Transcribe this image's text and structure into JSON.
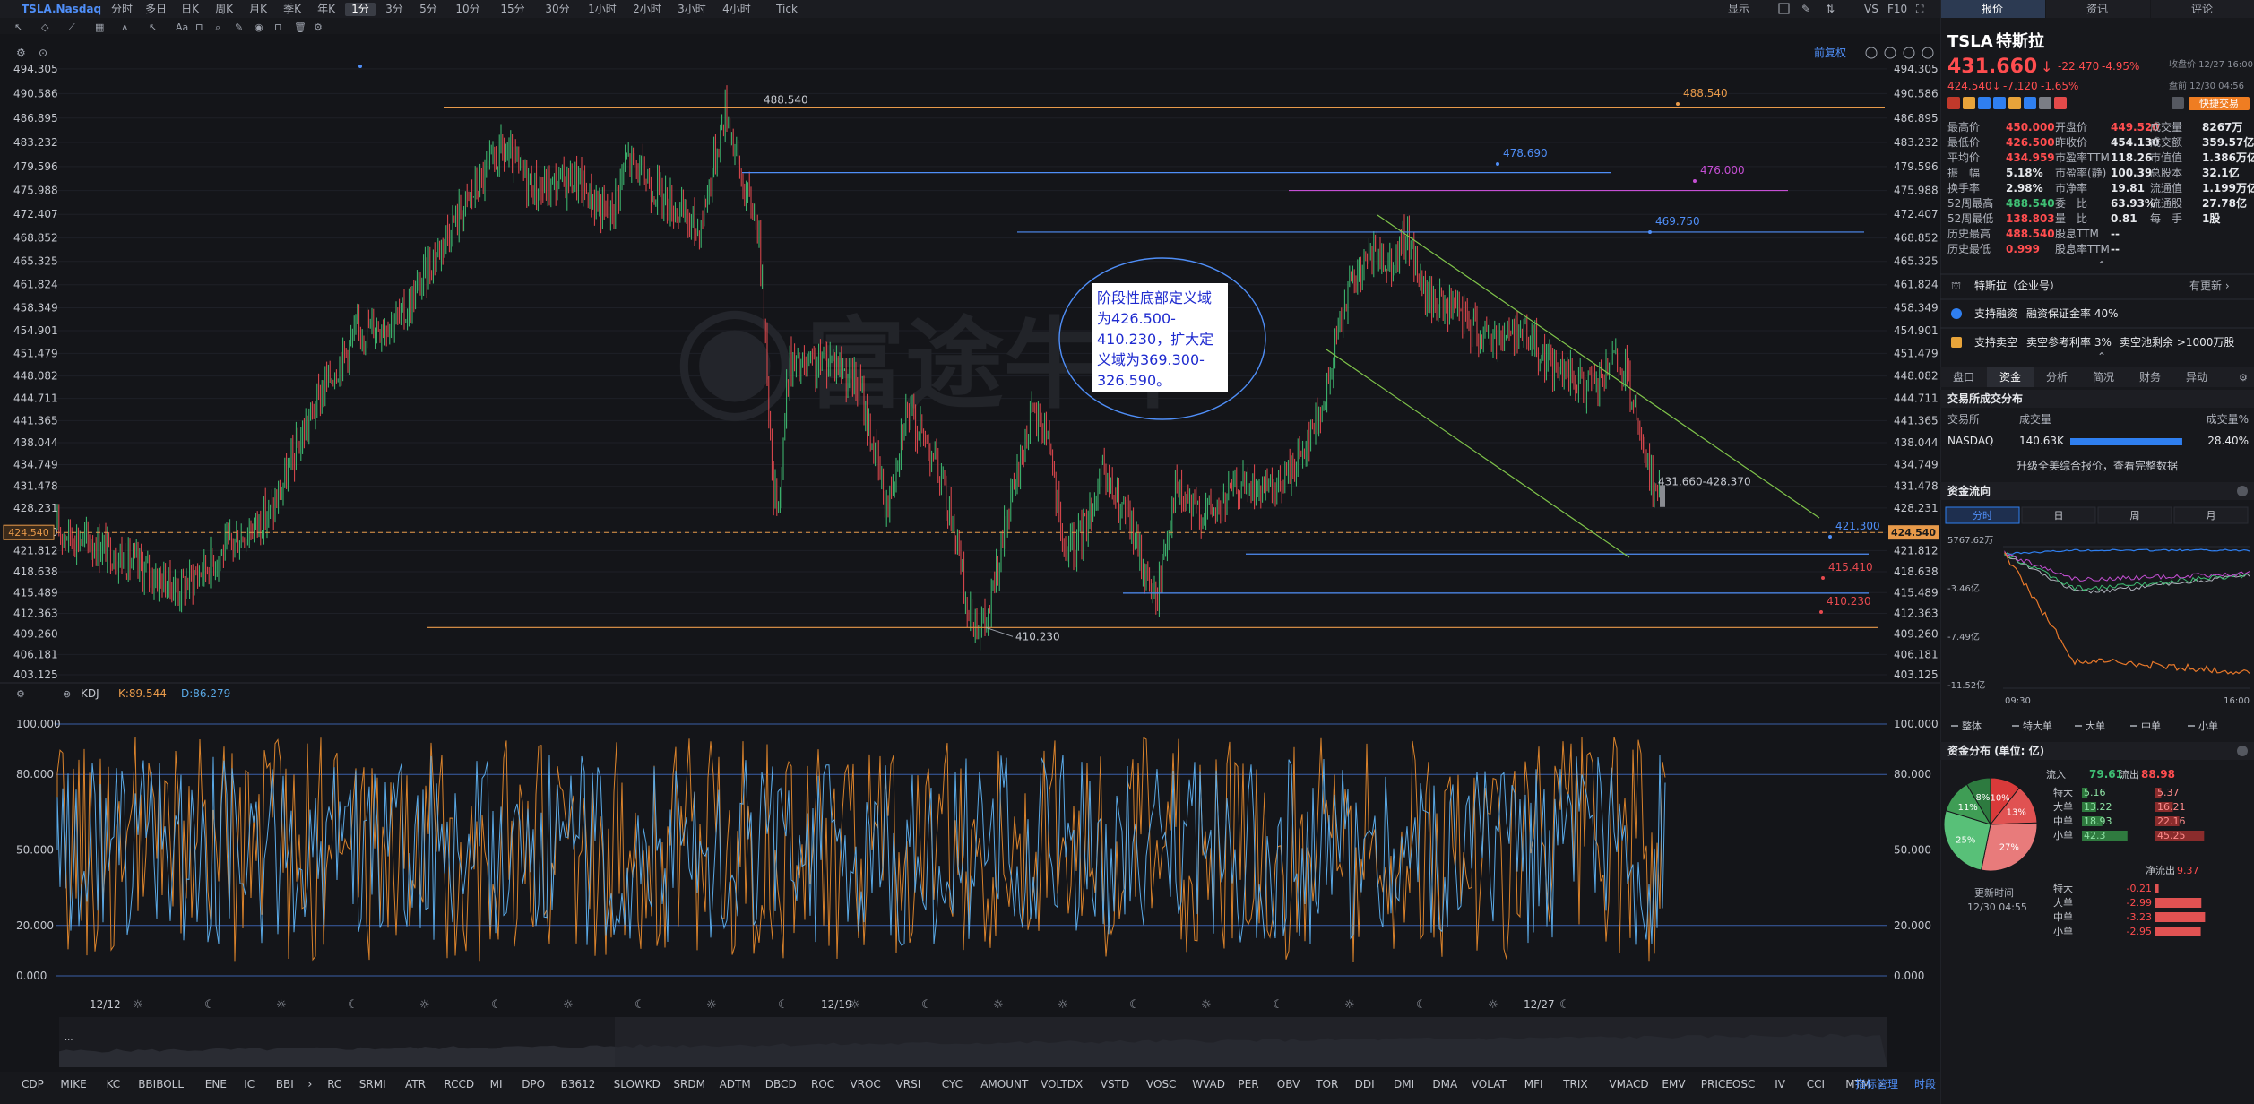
{
  "header": {
    "symbol": "TSLA.Nasdaq",
    "timeframes": [
      "分时",
      "多日",
      "日K",
      "周K",
      "月K",
      "季K",
      "年K",
      "1分",
      "3分",
      "5分",
      "10分",
      "15分",
      "30分",
      "1小时",
      "2小时",
      "3小时",
      "4小时",
      "Tick"
    ],
    "active_timeframe": "1分",
    "display_label": "显示",
    "vs_label": "VS",
    "f10_label": "F10",
    "adjust_label": "前复权"
  },
  "price_chart": {
    "y_ticks": [
      "494.305",
      "490.586",
      "486.895",
      "483.232",
      "479.596",
      "475.988",
      "472.407",
      "468.852",
      "465.325",
      "461.824",
      "458.349",
      "454.901",
      "451.479",
      "448.082",
      "444.711",
      "441.365",
      "438.044",
      "434.749",
      "431.478",
      "428.231",
      "424.540",
      "421.812",
      "418.638",
      "415.489",
      "412.363",
      "409.260",
      "406.181",
      "403.125"
    ],
    "y_range": [
      403.125,
      494.305
    ],
    "current_price_label": "424.540",
    "x_labels": [
      "12/12",
      "12/19",
      "12/27"
    ],
    "watermark": "富途牛牛",
    "annotations": {
      "high": "488.540",
      "low": "410.230",
      "current_range": "431.660-428.370",
      "right_levels": [
        "488.540",
        "478.690",
        "476.000",
        "469.750",
        "421.300",
        "415.410",
        "410.230"
      ]
    },
    "note_lines": [
      "阶段性底部定义域",
      "为426.500-",
      "410.230，扩大定",
      "义域为369.300-",
      "326.590。"
    ]
  },
  "kdj": {
    "name": "KDJ",
    "k_label": "K:89.544",
    "d_label": "D:86.279",
    "y_ticks": [
      "100.000",
      "80.000",
      "50.000",
      "20.000",
      "0.000"
    ]
  },
  "indicator_tabs": [
    "CDP",
    "MIKE",
    "KC",
    "BBIBOLL",
    "ENE",
    "IC",
    "BBI",
    "RC",
    "SRMI",
    "ATR",
    "RCCD",
    "MI",
    "DPO",
    "B3612",
    "SLOWKD",
    "SRDM",
    "ADTM",
    "DBCD",
    "ROC",
    "VROC",
    "VRSI",
    "CYC",
    "AMOUNT",
    "VOLTDX",
    "VSTD",
    "VOSC",
    "WVAD",
    "PER",
    "OBV",
    "TOR",
    "DDI",
    "DMI",
    "DMA",
    "VOLAT",
    "MFI",
    "TRIX",
    "VMACD",
    "EMV",
    "PRICEOSC",
    "IV",
    "CCI",
    "MTM"
  ],
  "indicator_manage_label": "指标管理",
  "time_label": "时段",
  "sidebar": {
    "tabs": [
      "报价",
      "资讯",
      "评论"
    ],
    "ticker": "TSLA",
    "name_cn": "特斯拉",
    "price": "431.660",
    "change": "-22.470",
    "change_pct": "-4.95%",
    "close_label": "收盘价 12/27 16:00",
    "after_price": "424.540",
    "after_change": "-7.120",
    "after_pct": "-1.65%",
    "after_label": "盘前 12/30 04:56",
    "quick_trade": "快捷交易",
    "stats": [
      [
        "最高价",
        "450.000",
        "开盘价",
        "449.520",
        "成交量",
        "8267万"
      ],
      [
        "最低价",
        "426.500",
        "昨收价",
        "454.130",
        "成交额",
        "359.57亿"
      ],
      [
        "平均价",
        "434.959",
        "市盈率TTM",
        "118.26",
        "市值值",
        "1.386万亿"
      ],
      [
        "振　幅",
        "5.18%",
        "市盈率(静)",
        "100.39",
        "总股本",
        "32.1亿"
      ],
      [
        "换手率",
        "2.98%",
        "市净率",
        "19.81",
        "流通值",
        "1.199万亿"
      ],
      [
        "52周最高",
        "488.540",
        "委　比",
        "63.93%",
        "流通股",
        "27.78亿"
      ],
      [
        "52周最低",
        "138.803",
        "量　比",
        "0.81",
        "每　手",
        "1股"
      ],
      [
        "历史最高",
        "488.540",
        "股息TTM",
        "--",
        "",
        ""
      ],
      [
        "历史最低",
        "0.999",
        "股息率TTM",
        "--",
        "",
        ""
      ]
    ],
    "company_row": "特斯拉（企业号）",
    "company_update": "有更新",
    "margin_row": "支持融资",
    "margin_rate": "融资保证金率 40%",
    "short_row": "支持卖空",
    "short_rate": "卖空参考利率 3%",
    "short_pool": "卖空池剩余 >1000万股",
    "subtabs": [
      "盘口",
      "资金",
      "分析",
      "简况",
      "财务",
      "异动"
    ],
    "exchange_section": "交易所成交分布",
    "exchange_headers": [
      "交易所",
      "成交量",
      "成交量%"
    ],
    "exchange_row": [
      "NASDAQ",
      "140.63K",
      "28.40%"
    ],
    "exchange_bar_fraction": 0.284,
    "upgrade_text": "升级全美综合报价，查看完整数据",
    "flow_section": "资金流向",
    "flow_tabs": [
      "分时",
      "日",
      "周",
      "月"
    ],
    "flow_y": [
      "5767.62万",
      "-3.46亿",
      "-7.49亿",
      "-11.52亿"
    ],
    "flow_x": [
      "09:30",
      "16:00"
    ],
    "flow_legend": [
      "整体",
      "特大单",
      "大单",
      "中单",
      "小单"
    ],
    "dist_section": "资金分布 (单位: 亿)",
    "inflow_label": "流入",
    "inflow_total": "79.61",
    "outflow_label": "流出",
    "outflow_total": "88.98",
    "pie_slices": [
      {
        "label": "10%",
        "value": 10
      },
      {
        "label": "13%",
        "value": 13
      },
      {
        "label": "27%",
        "value": 27
      },
      {
        "label": "25%",
        "value": 25
      },
      {
        "label": "11%",
        "value": 11
      },
      {
        "label": "8%",
        "value": 8
      }
    ],
    "dist_rows": [
      [
        "特大",
        "5.16",
        "5.37"
      ],
      [
        "大单",
        "13.22",
        "16.21"
      ],
      [
        "中单",
        "18.93",
        "22.16"
      ],
      [
        "小单",
        "42.3",
        "45.25"
      ]
    ],
    "net_label": "净流出",
    "net_value": "9.37",
    "update_label": "更新时间",
    "update_time": "12/30 04:55",
    "net_rows": [
      [
        "特大",
        "-0.21"
      ],
      [
        "大单",
        "-2.99"
      ],
      [
        "中单",
        "-3.23"
      ],
      [
        "小单",
        "-2.95"
      ]
    ]
  }
}
